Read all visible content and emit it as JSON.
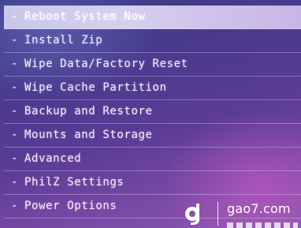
{
  "bullet": "-",
  "menu": {
    "items": [
      {
        "label": "Reboot System Now",
        "selected": true
      },
      {
        "label": "Install Zip",
        "selected": false
      },
      {
        "label": "Wipe Data/Factory Reset",
        "selected": false
      },
      {
        "label": "Wipe Cache Partition",
        "selected": false
      },
      {
        "label": "Backup and Restore",
        "selected": false
      },
      {
        "label": "Mounts and Storage",
        "selected": false
      },
      {
        "label": "Advanced",
        "selected": false
      },
      {
        "label": "PhilZ Settings",
        "selected": false
      },
      {
        "label": "Power Options",
        "selected": false
      }
    ]
  },
  "watermark": {
    "site": "gao7.com",
    "logo_icon": "gao7-logo-icon"
  },
  "colors": {
    "background": "#4a3a8e",
    "highlight": "#d6d0ef",
    "text": "#f2eefb"
  }
}
